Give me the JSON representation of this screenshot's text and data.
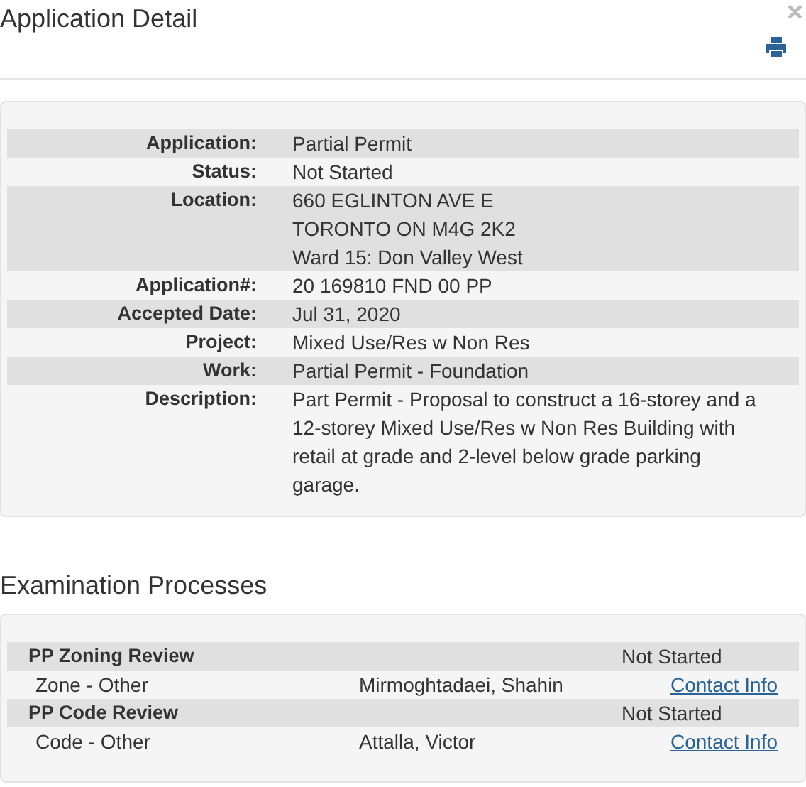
{
  "title": "Application Detail",
  "close_label": "×",
  "details": [
    {
      "label": "Application:",
      "lines": [
        "Partial Permit"
      ]
    },
    {
      "label": "Status:",
      "lines": [
        "Not Started"
      ]
    },
    {
      "label": "Location:",
      "lines": [
        "660 EGLINTON AVE E",
        "TORONTO ON M4G 2K2",
        "Ward 15: Don Valley West"
      ]
    },
    {
      "label": "Application#:",
      "lines": [
        "20 169810 FND 00 PP"
      ]
    },
    {
      "label": "Accepted Date:",
      "lines": [
        "Jul 31, 2020"
      ]
    },
    {
      "label": "Project:",
      "lines": [
        "Mixed Use/Res w Non Res"
      ]
    },
    {
      "label": "Work:",
      "lines": [
        "Partial Permit - Foundation"
      ]
    },
    {
      "label": "Description:",
      "lines": [
        "Part Permit - Proposal to construct a 16-storey and a 12-storey Mixed Use/Res w Non Res Building with retail at grade and 2-level below grade parking garage."
      ]
    }
  ],
  "examination": {
    "title": "Examination Processes",
    "processes": [
      {
        "name": "PP Zoning Review",
        "status": "Not Started",
        "type": "Zone - Other",
        "examiner": "Mirmoghtadaei, Shahin",
        "link": "Contact Info"
      },
      {
        "name": "PP Code Review",
        "status": "Not Started",
        "type": "Code - Other",
        "examiner": "Attalla, Victor",
        "link": "Contact Info"
      }
    ]
  }
}
